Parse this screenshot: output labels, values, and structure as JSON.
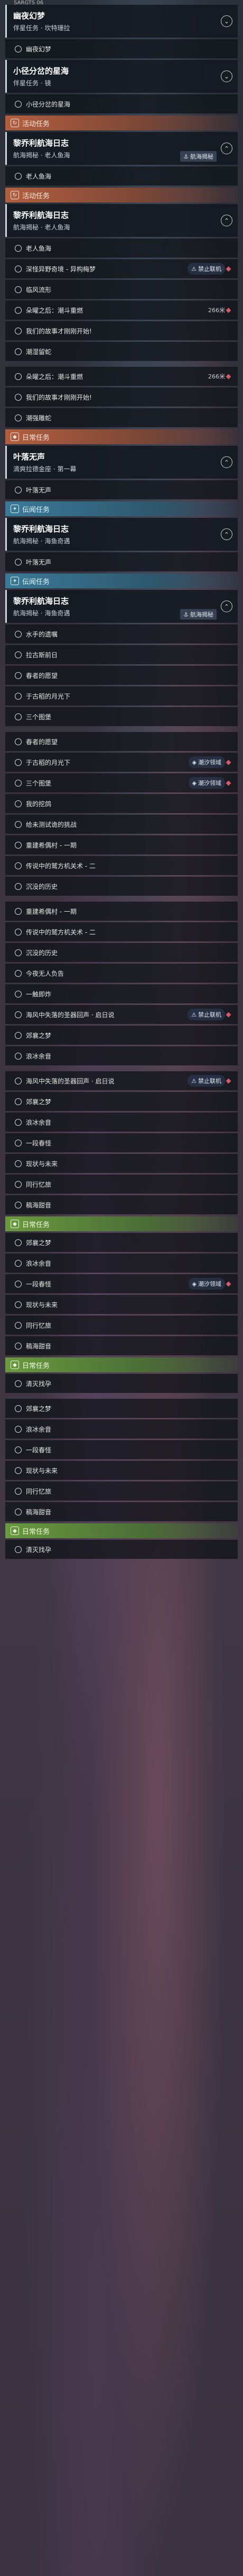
{
  "header_label": "SARGTS 06",
  "rows": [
    {
      "t": "quest",
      "title": "幽夜幻梦",
      "sub": "伴星任务 · 坎特珊拉",
      "chev": "⌄"
    },
    {
      "t": "step",
      "label": "幽夜幻梦"
    },
    {
      "t": "quest",
      "title": "小径分岔的星海",
      "sub": "伴星任务 · 镜",
      "chev": "⌄"
    },
    {
      "t": "step",
      "label": "小径分岔的星海"
    },
    {
      "t": "cat",
      "cls": "cat-event",
      "label": "活动任务",
      "badge": "↻"
    },
    {
      "t": "quest",
      "title": "黎乔利航海日志",
      "sub": "航海揭秘 · 老人鱼海",
      "chev": "⌃",
      "tag": "航海揭秘",
      "tagIcon": "⚓"
    },
    {
      "t": "step",
      "label": "老人鱼海"
    },
    {
      "t": "cat",
      "cls": "cat-event",
      "label": "活动任务",
      "badge": "↻"
    },
    {
      "t": "quest",
      "title": "黎乔利航海日志",
      "sub": "航海揭秘 · 老人鱼海",
      "chev": "⌃"
    },
    {
      "t": "step",
      "label": "老人鱼海"
    },
    {
      "t": "step",
      "label": "深怪异野奇境 - 异构梅梦",
      "tag": "禁止联机",
      "tagIcon": "⚠",
      "dist": "315米"
    },
    {
      "t": "step",
      "label": "临风流形"
    },
    {
      "t": "step",
      "label": "朵曜之后：潮斗重燃",
      "dist": "266米"
    },
    {
      "t": "step",
      "label": "我们的故事才刚刚开始!"
    },
    {
      "t": "step",
      "label": "潮湿留蛇"
    },
    {
      "t": "gap"
    },
    {
      "t": "step",
      "label": "朵曜之后：潮斗重燃",
      "dist": "266米"
    },
    {
      "t": "step",
      "label": "我们的故事才刚刚开始!"
    },
    {
      "t": "step",
      "label": "潮强雕蛇"
    },
    {
      "t": "cat",
      "cls": "cat-event",
      "label": "日常任务",
      "badge": "◆"
    },
    {
      "t": "quest",
      "title": "叶落无声",
      "sub": "滴爽拉德金座 · 第一幕",
      "chev": "⌃"
    },
    {
      "t": "step",
      "label": "叶落无声"
    },
    {
      "t": "cat",
      "cls": "cat-side",
      "label": "伝闻任务",
      "badge": "✦"
    },
    {
      "t": "quest",
      "title": "黎乔利航海日志",
      "sub": "航海揭秘 · 海鱼奇遇",
      "chev": "⌃"
    },
    {
      "t": "step",
      "label": "叶落无声"
    },
    {
      "t": "cat",
      "cls": "cat-side",
      "label": "伝闻任务",
      "badge": "✦"
    },
    {
      "t": "quest",
      "title": "黎乔利航海日志",
      "sub": "航海揭秘 · 海鱼奇遇",
      "chev": "⌃",
      "tag": "航海揭秘",
      "tagIcon": "⚓"
    },
    {
      "t": "step",
      "label": "水手的遗嘱"
    },
    {
      "t": "step",
      "label": "拉古斯前日"
    },
    {
      "t": "step",
      "label": "春者的愿望"
    },
    {
      "t": "step",
      "label": "于古稻的月光下"
    },
    {
      "t": "step",
      "label": "三个图堡"
    },
    {
      "t": "gap"
    },
    {
      "t": "step",
      "label": "春者的愿望"
    },
    {
      "t": "step",
      "label": "于古稻的月光下",
      "tag": "潮汐领域",
      "tagIcon": "◈"
    },
    {
      "t": "step",
      "label": "三个图堡",
      "tag": "潮汐领域",
      "tagIcon": "◈"
    },
    {
      "t": "step",
      "label": "我的挖鸽"
    },
    {
      "t": "step",
      "label": "给未测试诡的挑战"
    },
    {
      "t": "step",
      "label": "重建希偶村 - 一期"
    },
    {
      "t": "step",
      "label": "传说中的鹫方机关术 - 二"
    },
    {
      "t": "step",
      "label": "沉没的历史"
    },
    {
      "t": "gap"
    },
    {
      "t": "step",
      "label": "重建希偶村 - 一期"
    },
    {
      "t": "step",
      "label": "传说中的鹫方机关术 - 二"
    },
    {
      "t": "step",
      "label": "沉没的历史"
    },
    {
      "t": "step",
      "label": "今夜无人负告"
    },
    {
      "t": "step",
      "label": "一触即炸"
    },
    {
      "t": "step",
      "label": "海风中失落的圣器回声 · 启日说",
      "tag": "禁止联机",
      "tagIcon": "⚠"
    },
    {
      "t": "step",
      "label": "郊襄之梦"
    },
    {
      "t": "step",
      "label": "浪冰余音"
    },
    {
      "t": "gap"
    },
    {
      "t": "step",
      "label": "海风中失落的圣器回声 · 启日说",
      "tag": "禁止联机",
      "tagIcon": "⚠"
    },
    {
      "t": "step",
      "label": "郊襄之梦"
    },
    {
      "t": "step",
      "label": "浪冰余音"
    },
    {
      "t": "step",
      "label": "一段春怪"
    },
    {
      "t": "step",
      "label": "现状与未来"
    },
    {
      "t": "step",
      "label": "同行忆旅"
    },
    {
      "t": "step",
      "label": "稿海甜音"
    },
    {
      "t": "cat",
      "cls": "cat-daily",
      "label": "日常任务",
      "badge": "◆"
    },
    {
      "t": "step",
      "label": "郊襄之梦"
    },
    {
      "t": "step",
      "label": "浪冰余音"
    },
    {
      "t": "step",
      "label": "一段春怪",
      "tag": "潮汐领域",
      "tagIcon": "◈"
    },
    {
      "t": "step",
      "label": "现状与未来"
    },
    {
      "t": "step",
      "label": "同行忆旅"
    },
    {
      "t": "step",
      "label": "稿海甜音"
    },
    {
      "t": "cat",
      "cls": "cat-daily",
      "label": "日常任务",
      "badge": "◆"
    },
    {
      "t": "step",
      "label": "清灭找孕"
    },
    {
      "t": "gap"
    },
    {
      "t": "step",
      "label": "郊襄之梦"
    },
    {
      "t": "step",
      "label": "浪冰余音"
    },
    {
      "t": "step",
      "label": "一段春怪"
    },
    {
      "t": "step",
      "label": "现状与未来"
    },
    {
      "t": "step",
      "label": "同行忆旅"
    },
    {
      "t": "step",
      "label": "稿海甜音"
    },
    {
      "t": "cat",
      "cls": "cat-daily",
      "label": "日常任务",
      "badge": "◆"
    },
    {
      "t": "step",
      "label": "清灭找孕"
    }
  ]
}
